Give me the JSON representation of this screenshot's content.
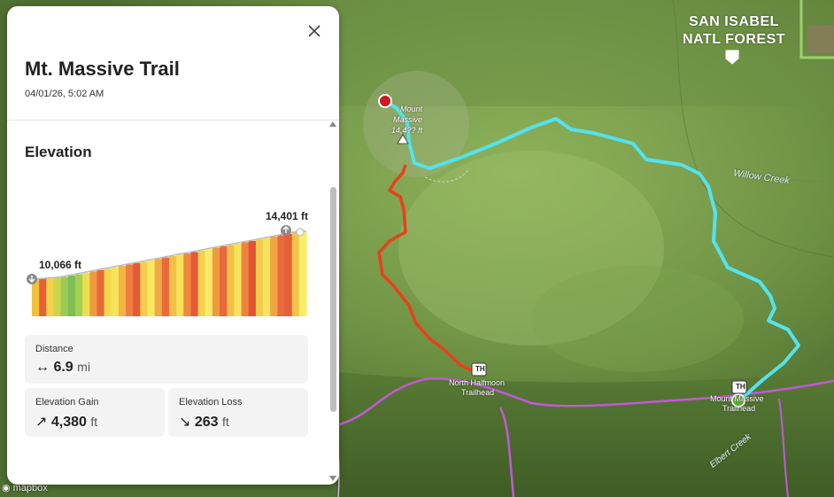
{
  "map": {
    "labels": {
      "forest_line1": "SAN ISABEL",
      "forest_line2": "NATL FOREST",
      "summit_line1": "Mount",
      "summit_line2": "Massive",
      "summit_line3": "14,4?? ft",
      "willow_creek": "Willow Creek",
      "north_halfmoon_1": "North Halfmoon",
      "north_halfmoon_2": "Trailhead",
      "mount_massive_th_1": "Mount Massive",
      "mount_massive_th_2": "Trailhead",
      "elbert_creek": "Elbert Creek",
      "th_badge": "TH",
      "attribution": "mapbox"
    },
    "route_colors": {
      "ascent_cyan": "#52e3ef",
      "descent_red": "#e8401c",
      "boundary_purple": "#c458d8",
      "start_marker": "#58b02a",
      "end_marker": "#d01920"
    }
  },
  "panel": {
    "title": "Mt. Massive Trail",
    "date": "04/01/26, 5:02 AM",
    "elevation_heading": "Elevation",
    "chart": {
      "max_label": "14,401 ft",
      "min_label": "10,066 ft"
    },
    "stats": {
      "distance": {
        "label": "Distance",
        "icon": "↔",
        "value": "6.9",
        "unit": "mi"
      },
      "gain": {
        "label": "Elevation Gain",
        "icon": "↗",
        "value": "4,380",
        "unit": "ft"
      },
      "loss": {
        "label": "Elevation Loss",
        "icon": "↘",
        "value": "263",
        "unit": "ft"
      }
    }
  },
  "chart_data": {
    "type": "area",
    "ylabel": "",
    "xlabel": "",
    "ylim": [
      10066,
      14401
    ],
    "y_min_label": "10,066 ft",
    "y_max_label": "14,401 ft"
  }
}
